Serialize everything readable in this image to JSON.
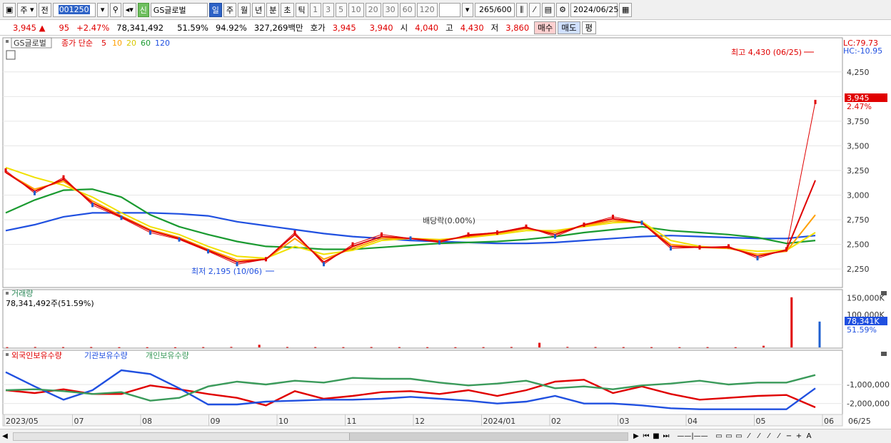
{
  "toolbar": {
    "period_mode": "주",
    "prev_label": "전",
    "stock_code": "001250",
    "credit_badge": "신",
    "stock_name": "GS글로벌",
    "periods": [
      "일",
      "주",
      "월",
      "년",
      "분",
      "초",
      "틱"
    ],
    "active_period": "일",
    "ticks": [
      "1",
      "3",
      "5",
      "10",
      "20",
      "30",
      "60",
      "120"
    ],
    "count": "265",
    "count_total": "/600",
    "date": "2024/06/25"
  },
  "quote": {
    "price": "3,945",
    "arrow": "▲",
    "change": "95",
    "change_pct": "+2.47%",
    "volume": "78,341,492",
    "volume_pct": "51.59%",
    "ratio": "94.92%",
    "amount": "327,269백만",
    "ask_label": "호가",
    "ask": "3,945",
    "bid": "3,940",
    "open_label": "시",
    "open": "4,040",
    "high_label": "고",
    "high": "4,430",
    "low_label": "저",
    "low": "3,860",
    "buy_label": "매수",
    "sell_label": "매도",
    "eval_label": "평"
  },
  "legend": {
    "stock": "GS글로벌",
    "ma_prefix": "종가 단순",
    "ma5": "5",
    "ma10": "10",
    "ma20": "20",
    "ma60": "60",
    "ma120": "120",
    "lc": "LC:79.73",
    "hc": "HC:-10.95"
  },
  "annotations": {
    "max_label": "최고 4,430 (06/25)",
    "min_label": "최저 2,195 (10/06)",
    "dividend_label": "배당락(0.00%)",
    "current_price_tag": "3,945",
    "current_pct_tag": "2.47%"
  },
  "volume_panel": {
    "title": "거래량",
    "value": "78,341,492주(51.59%)",
    "current_tag": "78,341K",
    "current_pct": "51.59%"
  },
  "holding_panel": {
    "foreign": "외국인보유수량",
    "institution": "기관보유수량",
    "individual": "개인보유수량"
  },
  "colors": {
    "up": "#e00000",
    "down": "#1e5fd0",
    "ma5": "#e00000",
    "ma10": "#ff9f00",
    "ma20": "#f0e000",
    "ma60": "#1a9a30",
    "ma120": "#2050e0",
    "foreign": "#e00000",
    "institution": "#2050e0",
    "individual": "#3a9a5a"
  },
  "chart_data": [
    {
      "type": "line",
      "title": "",
      "y_ticks": [
        "4,250",
        "4,000",
        "3,750",
        "3,500",
        "3,250",
        "3,000",
        "2,750",
        "2,500",
        "2,250"
      ],
      "x_ticks": [
        "2023/05",
        "07",
        "08",
        "09",
        "10",
        "11",
        "12",
        "2024/01",
        "02",
        "03",
        "04",
        "05",
        "06",
        "06/25"
      ],
      "ylim": [
        2150,
        4480
      ],
      "series": [
        {
          "name": "종가",
          "values": [
            3250,
            3020,
            3180,
            2900,
            2770,
            2620,
            2550,
            2430,
            2300,
            2350,
            2620,
            2300,
            2500,
            2600,
            2560,
            2520,
            2600,
            2620,
            2680,
            2580,
            2700,
            2780,
            2720,
            2460,
            2470,
            2480,
            2360,
            2450,
            3945
          ]
        },
        {
          "name": "5",
          "values": [
            3230,
            3040,
            3160,
            2920,
            2780,
            2640,
            2560,
            2440,
            2320,
            2350,
            2600,
            2320,
            2480,
            2580,
            2560,
            2530,
            2590,
            2620,
            2670,
            2600,
            2700,
            2760,
            2720,
            2480,
            2470,
            2470,
            2380,
            2440,
            3150
          ]
        },
        {
          "name": "10",
          "values": [
            3230,
            3060,
            3140,
            2940,
            2790,
            2650,
            2570,
            2450,
            2340,
            2350,
            2560,
            2350,
            2460,
            2560,
            2560,
            2540,
            2580,
            2610,
            2660,
            2620,
            2690,
            2740,
            2720,
            2500,
            2470,
            2460,
            2400,
            2430,
            2800
          ]
        },
        {
          "name": "20",
          "values": [
            3280,
            3180,
            3100,
            2980,
            2820,
            2680,
            2600,
            2480,
            2380,
            2360,
            2480,
            2400,
            2440,
            2540,
            2560,
            2550,
            2570,
            2600,
            2640,
            2640,
            2680,
            2720,
            2730,
            2540,
            2480,
            2460,
            2430,
            2440,
            2620
          ]
        },
        {
          "name": "60",
          "values": [
            2820,
            2950,
            3050,
            3060,
            2980,
            2800,
            2680,
            2600,
            2530,
            2480,
            2470,
            2450,
            2450,
            2470,
            2490,
            2510,
            2520,
            2530,
            2550,
            2580,
            2620,
            2650,
            2680,
            2640,
            2620,
            2600,
            2570,
            2510,
            2540
          ]
        },
        {
          "name": "120",
          "values": [
            2640,
            2700,
            2780,
            2820,
            2820,
            2820,
            2810,
            2790,
            2730,
            2690,
            2650,
            2610,
            2580,
            2560,
            2540,
            2530,
            2520,
            2510,
            2510,
            2520,
            2540,
            2560,
            2580,
            2590,
            2580,
            2570,
            2560,
            2560,
            2590
          ]
        }
      ]
    },
    {
      "type": "bar",
      "title": "거래량",
      "y_ticks": [
        "150,000K",
        "100,000K"
      ],
      "ylim": [
        0,
        160000
      ],
      "values": [
        800,
        1200,
        900,
        1100,
        700,
        600,
        500,
        900,
        1500,
        8000,
        1200,
        900,
        800,
        1100,
        900,
        700,
        600,
        800,
        1200,
        14000,
        1500,
        1100,
        900,
        800,
        700,
        900,
        600,
        5000,
        151800,
        78341
      ]
    },
    {
      "type": "line",
      "title": "보유수량",
      "y_ticks": [
        "-1,000,000",
        "-2,000,000"
      ],
      "ylim": [
        -2500000,
        200000
      ],
      "series": [
        {
          "name": "외국인보유수량",
          "values": [
            -1300000,
            -1450000,
            -1250000,
            -1500000,
            -1500000,
            -1050000,
            -1250000,
            -1500000,
            -1700000,
            -2100000,
            -1350000,
            -1750000,
            -1600000,
            -1400000,
            -1350000,
            -1500000,
            -1300000,
            -1600000,
            -1300000,
            -850000,
            -750000,
            -1450000,
            -1100000,
            -1500000,
            -1800000,
            -1700000,
            -1600000,
            -1550000,
            -2200000
          ]
        },
        {
          "name": "기관보유수량",
          "values": [
            -350000,
            -1100000,
            -1800000,
            -1300000,
            -250000,
            -450000,
            -1200000,
            -2050000,
            -2050000,
            -1900000,
            -1850000,
            -1800000,
            -1800000,
            -1750000,
            -1650000,
            -1750000,
            -1850000,
            -2000000,
            -1900000,
            -1600000,
            -2000000,
            -2000000,
            -2100000,
            -2250000,
            -2300000,
            -2300000,
            -2300000,
            -2300000,
            -1200000
          ]
        },
        {
          "name": "개인보유수량",
          "values": [
            -1300000,
            -1250000,
            -1350000,
            -1500000,
            -1400000,
            -1850000,
            -1700000,
            -1100000,
            -850000,
            -1000000,
            -800000,
            -900000,
            -650000,
            -700000,
            -700000,
            -900000,
            -1050000,
            -950000,
            -800000,
            -1200000,
            -1100000,
            -1250000,
            -1050000,
            -950000,
            -800000,
            -1000000,
            -900000,
            -900000,
            -500000
          ]
        }
      ]
    }
  ]
}
